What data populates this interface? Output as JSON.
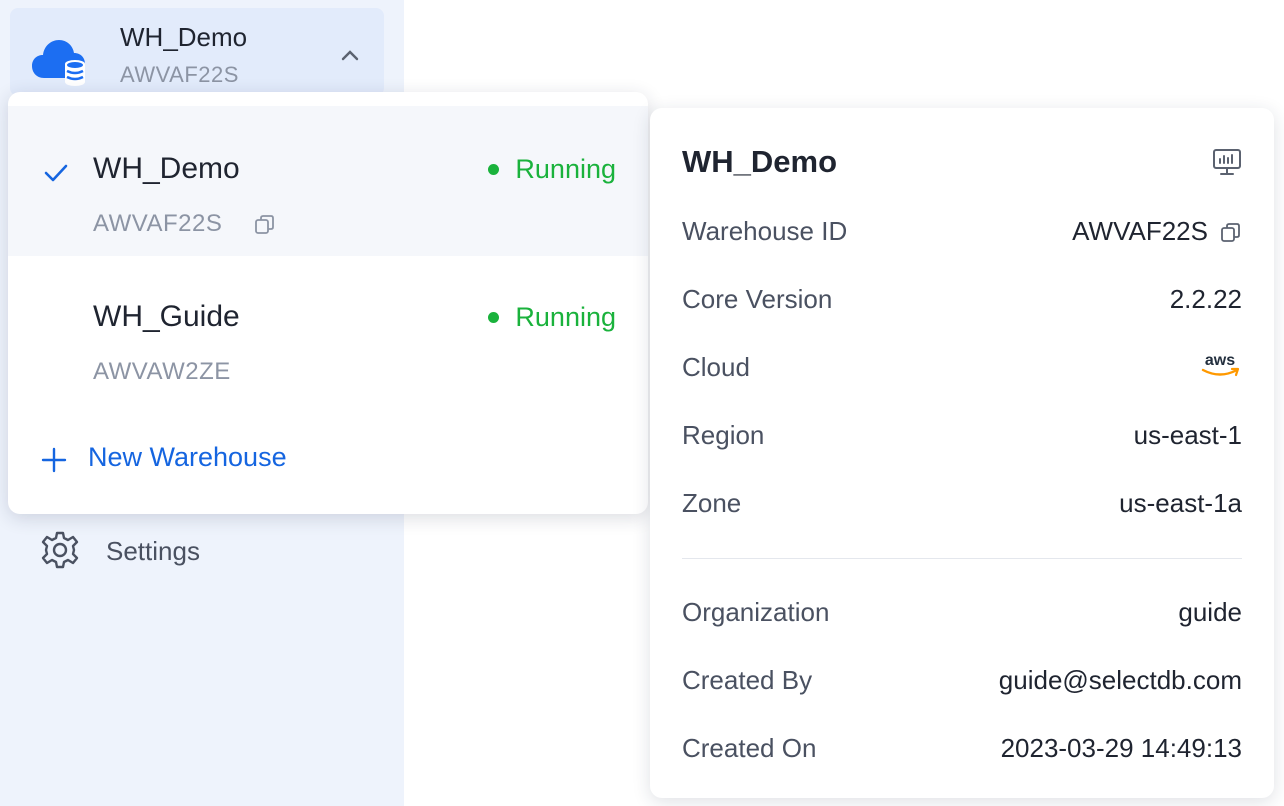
{
  "selector": {
    "name": "WH_Demo",
    "id": "AWVAF22S",
    "icon": "cloud-database-icon",
    "toggle_icon": "chevron-up-icon"
  },
  "sidebar": {
    "settings_label": "Settings",
    "settings_icon": "gear-icon"
  },
  "dropdown": {
    "items": [
      {
        "name": "WH_Demo",
        "id": "AWVAF22S",
        "status": "Running",
        "selected": true
      },
      {
        "name": "WH_Guide",
        "id": "AWVAW2ZE",
        "status": "Running",
        "selected": false
      }
    ],
    "new_label": "New Warehouse"
  },
  "details": {
    "title": "WH_Demo",
    "rows": [
      {
        "key": "Warehouse ID",
        "value": "AWVAF22S"
      },
      {
        "key": "Core Version",
        "value": "2.2.22"
      },
      {
        "key": "Cloud",
        "value": "aws"
      },
      {
        "key": "Region",
        "value": "us-east-1"
      },
      {
        "key": "Zone",
        "value": "us-east-1a"
      },
      {
        "key": "Organization",
        "value": "guide"
      },
      {
        "key": "Created By",
        "value": "guide@selectdb.com"
      },
      {
        "key": "Created On",
        "value": "2023-03-29 14:49:13"
      }
    ]
  },
  "colors": {
    "accent": "#1565e0",
    "running": "#1ab23c",
    "sidebar_bg": "#eef3fc"
  }
}
